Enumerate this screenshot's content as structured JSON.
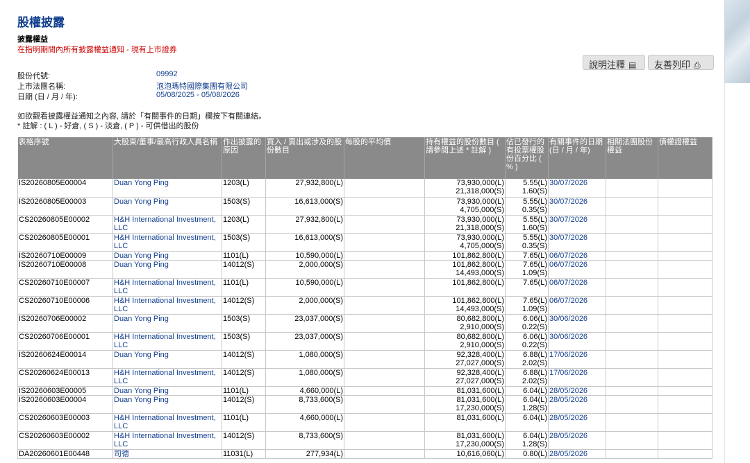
{
  "header": {
    "page_title": "股權披露",
    "section_title": "披露權益",
    "notice": "在指明期間內所有披露權益通知 - 現有上市證券",
    "notes_button": "說明注釋",
    "print_button": "友善列印"
  },
  "info": {
    "stock_code_label": "股份代號:",
    "stock_code": "09992",
    "company_label": "上市法團名稱:",
    "company": "泡泡瑪特國際集團有限公司",
    "date_label": "日期 (日 / 月 / 年):",
    "date_range": "05/08/2025 - 05/08/2026"
  },
  "instructions": {
    "line1": "如欲觀看披露權益通知之內容, 請於「有關事件的日期」欄按下有關連結。",
    "line2": "* 註解 : ( L ) - 好倉, ( S ) - 淡倉, ( P ) - 可供借出的股份"
  },
  "table": {
    "headers": [
      "表格序號",
      "大股東/董事/最高行政人員名稱",
      "作出披露的原因",
      "買入 / 賣出或涉及的股份數目",
      "每股的平均價",
      "持有權益的股份數目 ( 請參閱上述 * 註解 )",
      "佔已發行的有投票權股份百分比 ( % )",
      "有關事件的日期 (日 / 月 / 年)",
      "相關法團股份權益",
      "債權證權益"
    ],
    "rows": [
      {
        "id": "IS20260805E00004",
        "name": "Duan Yong Ping",
        "reason": "1203(L)",
        "shares": "27,932,800(L)",
        "avg": "",
        "held1": "73,930,000(L)",
        "held2": "21,318,000(S)",
        "pct1": "5.55(L)",
        "pct2": "1.60(S)",
        "date": "30/07/2026"
      },
      {
        "id": "IS20260805E00003",
        "name": "Duan Yong Ping",
        "reason": "1503(S)",
        "shares": "16,613,000(S)",
        "avg": "",
        "held1": "73,930,000(L)",
        "held2": "4,705,000(S)",
        "pct1": "5.55(L)",
        "pct2": "0.35(S)",
        "date": "30/07/2026"
      },
      {
        "id": "CS20260805E00002",
        "name": "H&H International Investment, LLC",
        "reason": "1203(L)",
        "shares": "27,932,800(L)",
        "avg": "",
        "held1": "73,930,000(L)",
        "held2": "21,318,000(S)",
        "pct1": "5.55(L)",
        "pct2": "1.60(S)",
        "date": "30/07/2026"
      },
      {
        "id": "CS20260805E00001",
        "name": "H&H International Investment, LLC",
        "reason": "1503(S)",
        "shares": "16,613,000(S)",
        "avg": "",
        "held1": "73,930,000(L)",
        "held2": "4,705,000(S)",
        "pct1": "5.55(L)",
        "pct2": "0.35(S)",
        "date": "30/07/2026"
      },
      {
        "id": "IS20260710E00009",
        "name": "Duan Yong Ping",
        "reason": "1101(L)",
        "shares": "10,590,000(L)",
        "avg": "",
        "held1": "101,862,800(L)",
        "held2": "",
        "pct1": "7.65(L)",
        "pct2": "",
        "date": "06/07/2026"
      },
      {
        "id": "IS20260710E00008",
        "name": "Duan Yong Ping",
        "reason": "14012(S)",
        "shares": "2,000,000(S)",
        "avg": "",
        "held1": "101,862,800(L)",
        "held2": "14,493,000(S)",
        "pct1": "7.65(L)",
        "pct2": "1.09(S)",
        "date": "06/07/2026"
      },
      {
        "id": "CS20260710E00007",
        "name": "H&H International Investment, LLC",
        "reason": "1101(L)",
        "shares": "10,590,000(L)",
        "avg": "",
        "held1": "101,862,800(L)",
        "held2": "",
        "pct1": "7.65(L)",
        "pct2": "",
        "date": "06/07/2026"
      },
      {
        "id": "CS20260710E00006",
        "name": "H&H International Investment, LLC",
        "reason": "14012(S)",
        "shares": "2,000,000(S)",
        "avg": "",
        "held1": "101,862,800(L)",
        "held2": "14,493,000(S)",
        "pct1": "7.65(L)",
        "pct2": "1.09(S)",
        "date": "06/07/2026"
      },
      {
        "id": "IS20260706E00002",
        "name": "Duan Yong Ping",
        "reason": "1503(S)",
        "shares": "23,037,000(S)",
        "avg": "",
        "held1": "80,682,800(L)",
        "held2": "2,910,000(S)",
        "pct1": "6.06(L)",
        "pct2": "0.22(S)",
        "date": "30/06/2026"
      },
      {
        "id": "CS20260706E00001",
        "name": "H&H International Investment, LLC",
        "reason": "1503(S)",
        "shares": "23,037,000(S)",
        "avg": "",
        "held1": "80,682,800(L)",
        "held2": "2,910,000(S)",
        "pct1": "6.06(L)",
        "pct2": "0.22(S)",
        "date": "30/06/2026"
      },
      {
        "id": "IS20260624E00014",
        "name": "Duan Yong Ping",
        "reason": "14012(S)",
        "shares": "1,080,000(S)",
        "avg": "",
        "held1": "92,328,400(L)",
        "held2": "27,027,000(S)",
        "pct1": "6.88(L)",
        "pct2": "2.02(S)",
        "date": "17/06/2026"
      },
      {
        "id": "CS20260624E00013",
        "name": "H&H International Investment, LLC",
        "reason": "14012(S)",
        "shares": "1,080,000(S)",
        "avg": "",
        "held1": "92,328,400(L)",
        "held2": "27,027,000(S)",
        "pct1": "6.88(L)",
        "pct2": "2.02(S)",
        "date": "17/06/2026"
      },
      {
        "id": "IS20260603E00005",
        "name": "Duan Yong Ping",
        "reason": "1101(L)",
        "shares": "4,660,000(L)",
        "avg": "",
        "held1": "81,031,600(L)",
        "held2": "",
        "pct1": "6.04(L)",
        "pct2": "",
        "date": "28/05/2026"
      },
      {
        "id": "IS20260603E00004",
        "name": "Duan Yong Ping",
        "reason": "14012(S)",
        "shares": "8,733,600(S)",
        "avg": "",
        "held1": "81,031,600(L)",
        "held2": "17,230,000(S)",
        "pct1": "6.04(L)",
        "pct2": "1.28(S)",
        "date": "28/05/2026"
      },
      {
        "id": "CS20260603E00003",
        "name": "H&H International Investment, LLC",
        "reason": "1101(L)",
        "shares": "4,660,000(L)",
        "avg": "",
        "held1": "81,031,600(L)",
        "held2": "",
        "pct1": "6.04(L)",
        "pct2": "",
        "date": "28/05/2026"
      },
      {
        "id": "CS20260603E00002",
        "name": "H&H International Investment, LLC",
        "reason": "14012(S)",
        "shares": "8,733,600(S)",
        "avg": "",
        "held1": "81,031,600(L)",
        "held2": "17,230,000(S)",
        "pct1": "6.04(L)",
        "pct2": "1.28(S)",
        "date": "28/05/2026"
      },
      {
        "id": "DA20260601E00448",
        "name": "司德",
        "reason": "11031(L)",
        "shares": "277,934(L)",
        "avg": "",
        "held1": "10,616,060(L)",
        "held2": "",
        "pct1": "0.80(L)",
        "pct2": "",
        "date": "28/05/2026"
      }
    ]
  }
}
